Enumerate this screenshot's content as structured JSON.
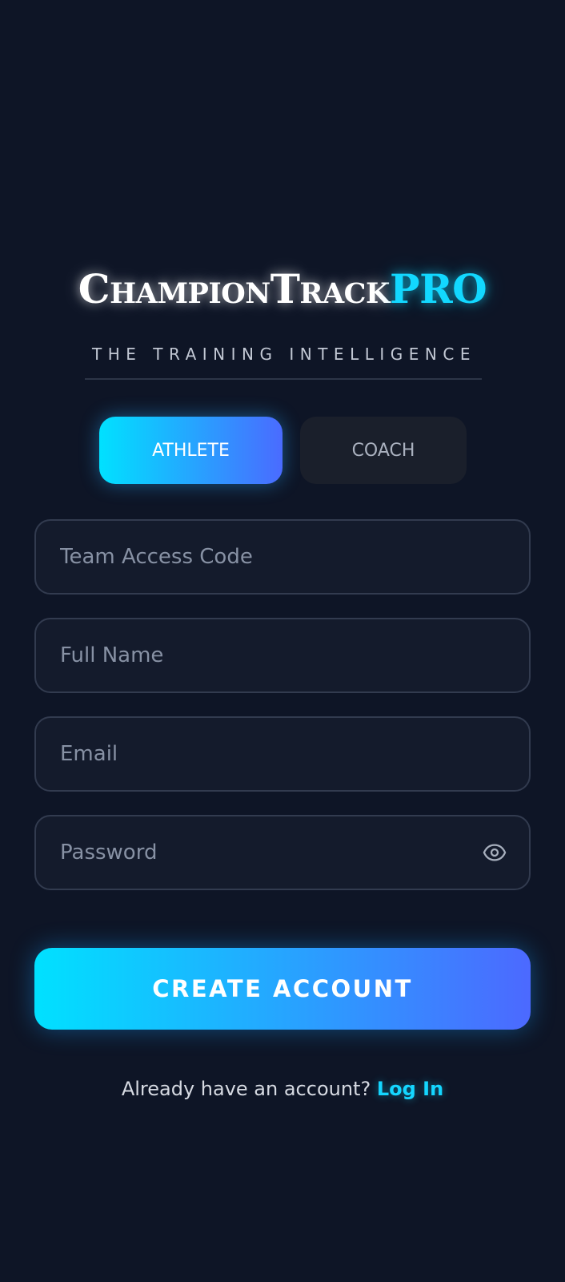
{
  "brand": {
    "name_main": "ChampionTrack",
    "name_pro": "PRO",
    "tagline": "THE TRAINING INTELLIGENCE"
  },
  "role_toggle": {
    "athlete_label": "ATHLETE",
    "coach_label": "COACH",
    "selected": "ATHLETE"
  },
  "form": {
    "team_code": {
      "placeholder": "Team Access Code",
      "value": ""
    },
    "full_name": {
      "placeholder": "Full Name",
      "value": ""
    },
    "email": {
      "placeholder": "Email",
      "value": ""
    },
    "password": {
      "placeholder": "Password",
      "value": "",
      "toggle_icon": "eye-icon"
    }
  },
  "actions": {
    "create_account_label": "CREATE ACCOUNT",
    "login_prompt": "Already have an account?",
    "login_link": "Log In"
  },
  "colors": {
    "background": "#0e1526",
    "accent_cyan": "#00e1ff",
    "accent_blue": "#4c69ff",
    "field_border": "#323b4f",
    "link": "#14d6ff"
  }
}
